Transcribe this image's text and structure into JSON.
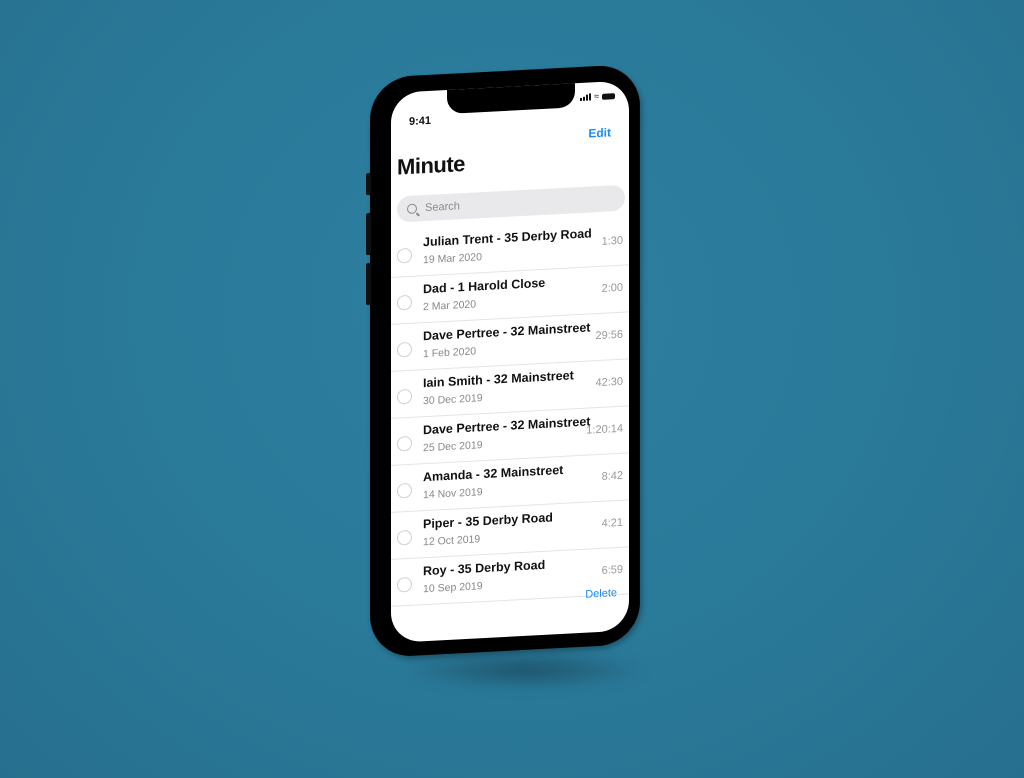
{
  "status_bar": {
    "time": "9:41"
  },
  "header": {
    "edit_label": "Edit",
    "title": "Minute"
  },
  "search": {
    "placeholder": "Search"
  },
  "recordings": [
    {
      "name": "Julian Trent - 35 Derby Road",
      "date": "19 Mar 2020",
      "duration": "1:30"
    },
    {
      "name": "Dad - 1 Harold Close",
      "date": "2 Mar 2020",
      "duration": "2:00"
    },
    {
      "name": "Dave Pertree - 32 Mainstreet",
      "date": "1 Feb 2020",
      "duration": "29:56"
    },
    {
      "name": "Iain Smith - 32 Mainstreet",
      "date": "30 Dec 2019",
      "duration": "42:30"
    },
    {
      "name": "Dave Pertree - 32 Mainstreet",
      "date": "25 Dec 2019",
      "duration": "1:20:14"
    },
    {
      "name": "Amanda  - 32 Mainstreet",
      "date": "14 Nov 2019",
      "duration": "8:42"
    },
    {
      "name": "Piper - 35 Derby Road",
      "date": "12 Oct 2019",
      "duration": "4:21"
    },
    {
      "name": "Roy - 35 Derby Road",
      "date": "10 Sep 2019",
      "duration": "6:59"
    }
  ],
  "footer": {
    "delete_label": "Delete"
  },
  "colors": {
    "accent": "#1a8cf0",
    "background": "#2a7a9a"
  }
}
